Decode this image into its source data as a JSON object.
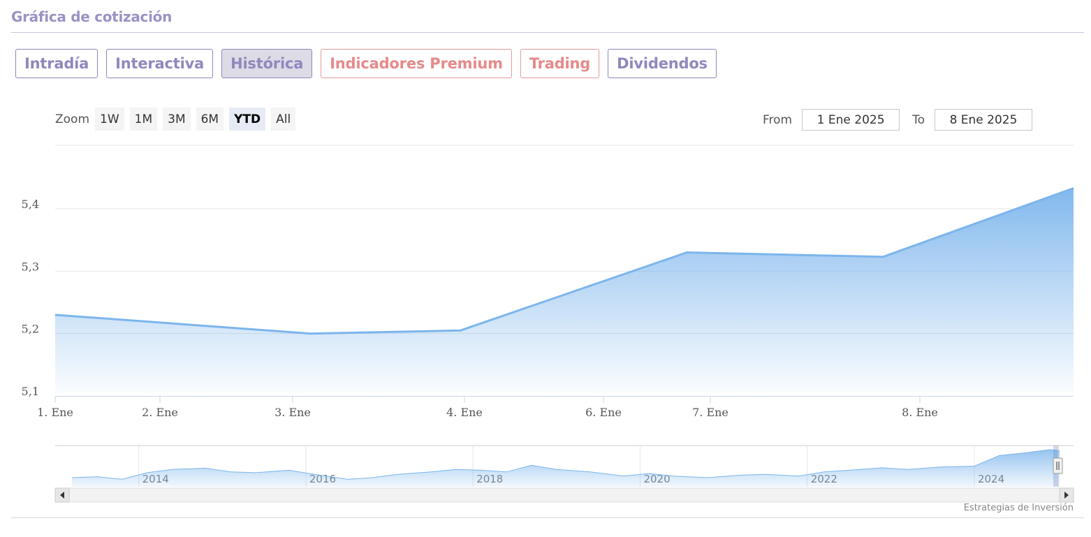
{
  "header": {
    "title": "Gráfica de cotización"
  },
  "tabs": [
    {
      "label": "Intradía",
      "kind": "normal",
      "active": false
    },
    {
      "label": "Interactiva",
      "kind": "normal",
      "active": false
    },
    {
      "label": "Histórica",
      "kind": "normal",
      "active": true
    },
    {
      "label": "Indicadores Premium",
      "kind": "premium",
      "active": false
    },
    {
      "label": "Trading",
      "kind": "premium",
      "active": false
    },
    {
      "label": "Dividendos",
      "kind": "normal",
      "active": false
    }
  ],
  "zoom": {
    "label": "Zoom",
    "buttons": [
      "1W",
      "1M",
      "3M",
      "6M",
      "YTD",
      "All"
    ],
    "selected": "YTD"
  },
  "range": {
    "from_label": "From",
    "from_value": "1 Ene 2025",
    "to_label": "To",
    "to_value": "8 Ene 2025"
  },
  "credits": "Estrategias de Inversión",
  "colors": {
    "tab_text": "#9088bd",
    "premium_text": "#e68a8a",
    "series_line": "#7cb5ec",
    "series_fill": "#7cb5ec"
  },
  "chart_data": {
    "type": "area",
    "title": "",
    "xlabel": "",
    "ylabel": "",
    "grid": true,
    "legend": "none",
    "ylim": [
      5.1,
      5.4
    ],
    "y_ticks": [
      "5,1",
      "5,2",
      "5,3",
      "5,4"
    ],
    "x_ticks": [
      {
        "label": "1. Ene",
        "x": 0
      },
      {
        "label": "2. Ene",
        "x": 1
      },
      {
        "label": "3. Ene",
        "x": 2
      },
      {
        "label": "4. Ene",
        "x": 3
      },
      {
        "label": "6. Ene",
        "x": 4
      },
      {
        "label": "7. Ene",
        "x": 5
      },
      {
        "label": "8. Ene",
        "x": 6
      }
    ],
    "xlim": [
      0,
      7.06
    ],
    "series": [
      {
        "x": [
          0,
          1.77,
          2.81,
          4.38,
          5.74,
          7.06
        ],
        "values": [
          5.23,
          5.2,
          5.205,
          5.33,
          5.323,
          5.433
        ]
      }
    ],
    "navigator": {
      "year_labels": [
        "2014",
        "2016",
        "2018",
        "2020",
        "2022",
        "2024"
      ],
      "years": [
        2014,
        2016,
        2018,
        2020,
        2022,
        2024
      ],
      "xlim": [
        2013,
        2025.02
      ],
      "ylim": [
        4.5,
        5.5
      ],
      "points": [
        [
          2013.2,
          4.72
        ],
        [
          2013.5,
          4.74
        ],
        [
          2013.8,
          4.68
        ],
        [
          2014.1,
          4.84
        ],
        [
          2014.4,
          4.92
        ],
        [
          2014.8,
          4.95
        ],
        [
          2015.1,
          4.86
        ],
        [
          2015.4,
          4.84
        ],
        [
          2015.8,
          4.9
        ],
        [
          2016.1,
          4.8
        ],
        [
          2016.5,
          4.68
        ],
        [
          2016.8,
          4.72
        ],
        [
          2017.1,
          4.8
        ],
        [
          2017.5,
          4.86
        ],
        [
          2017.8,
          4.92
        ],
        [
          2018.1,
          4.9
        ],
        [
          2018.4,
          4.86
        ],
        [
          2018.7,
          5.02
        ],
        [
          2019.0,
          4.92
        ],
        [
          2019.4,
          4.86
        ],
        [
          2019.8,
          4.76
        ],
        [
          2020.1,
          4.82
        ],
        [
          2020.4,
          4.76
        ],
        [
          2020.8,
          4.72
        ],
        [
          2021.2,
          4.78
        ],
        [
          2021.5,
          4.8
        ],
        [
          2021.9,
          4.76
        ],
        [
          2022.2,
          4.86
        ],
        [
          2022.5,
          4.9
        ],
        [
          2022.9,
          4.96
        ],
        [
          2023.2,
          4.92
        ],
        [
          2023.6,
          4.98
        ],
        [
          2024.0,
          5.0
        ],
        [
          2024.3,
          5.26
        ],
        [
          2024.6,
          5.32
        ],
        [
          2024.9,
          5.4
        ],
        [
          2025.02,
          5.38
        ]
      ]
    }
  }
}
